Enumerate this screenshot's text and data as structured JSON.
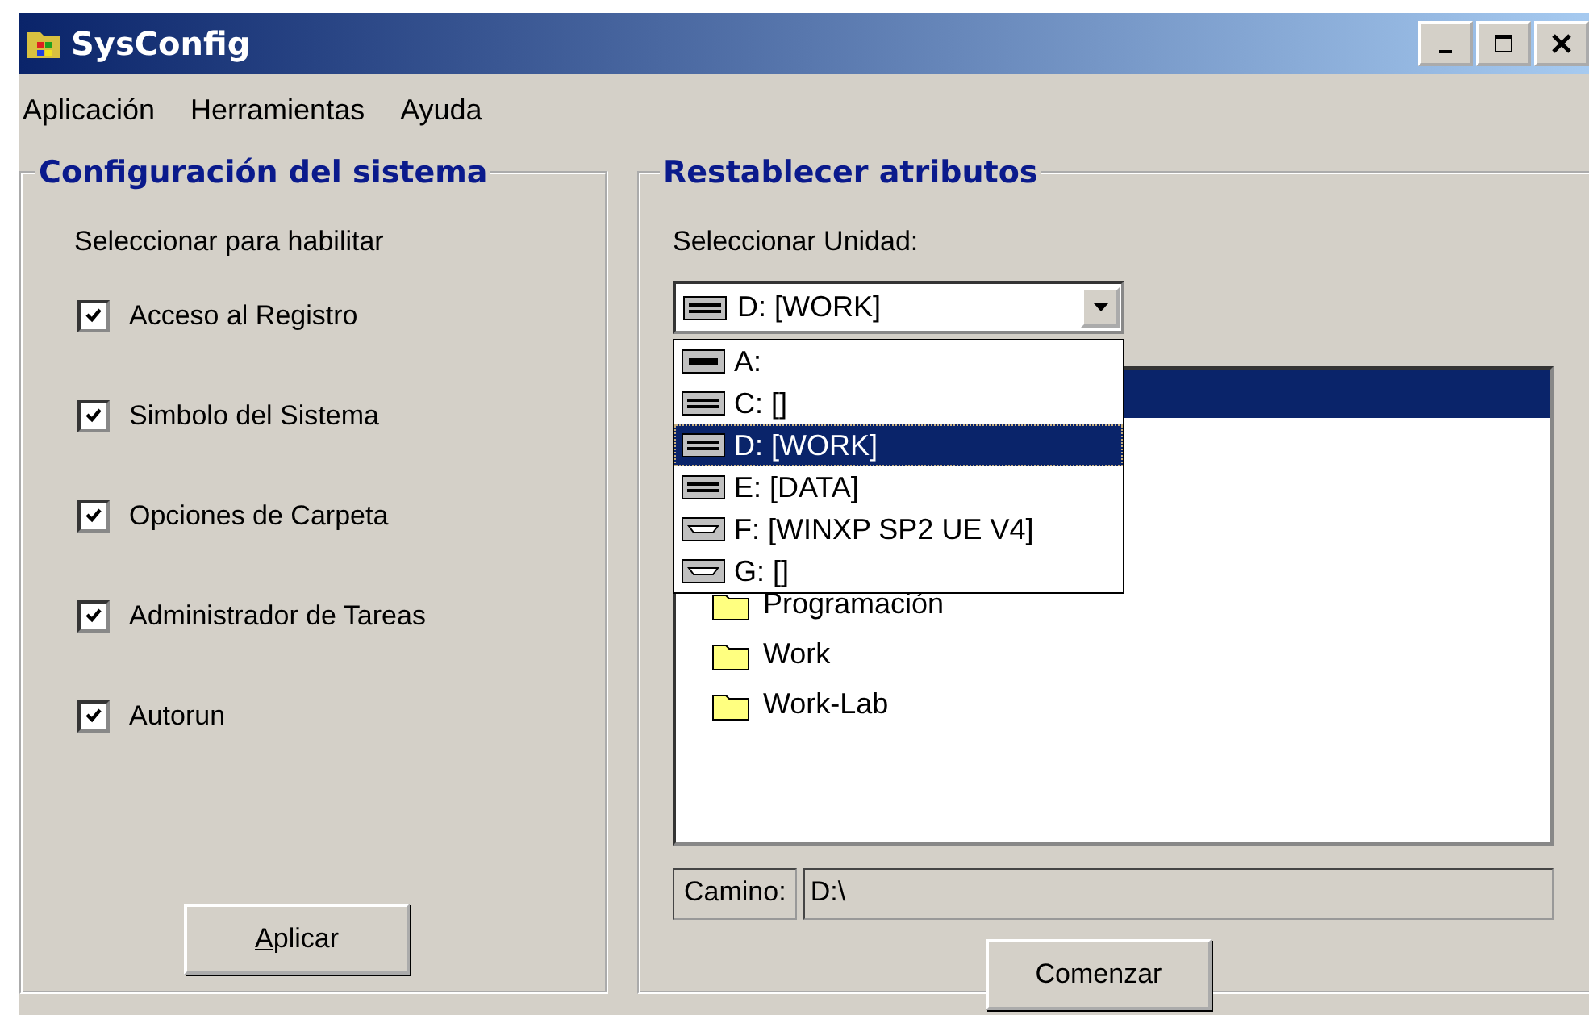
{
  "window": {
    "title": "SysConfig"
  },
  "menu": [
    "Aplicación",
    "Herramientas",
    "Ayuda"
  ],
  "left_panel": {
    "title": "Configuración del sistema",
    "subtitle": "Seleccionar para habilitar",
    "options": [
      {
        "label": "Acceso al Registro",
        "checked": true
      },
      {
        "label": "Simbolo del Sistema",
        "checked": true
      },
      {
        "label": "Opciones de Carpeta",
        "checked": true
      },
      {
        "label": "Administrador de Tareas",
        "checked": true
      },
      {
        "label": "Autorun",
        "checked": true
      }
    ],
    "button": "Aplicar"
  },
  "right_panel": {
    "title": "Restablecer atributos",
    "drive_label": "Seleccionar Unidad:",
    "drive_combo": {
      "value": "D: [WORK]",
      "kind": "hdd"
    },
    "drives": [
      {
        "label": "A:",
        "kind": "floppy",
        "selected": false
      },
      {
        "label": "C: []",
        "kind": "hdd",
        "selected": false
      },
      {
        "label": "D: [WORK]",
        "kind": "hdd",
        "selected": true
      },
      {
        "label": "E: [DATA]",
        "kind": "hdd",
        "selected": false
      },
      {
        "label": "F: [WINXP SP2 UE V4]",
        "kind": "cdrom",
        "selected": false
      },
      {
        "label": "G: []",
        "kind": "cdrom",
        "selected": false
      }
    ],
    "folders": [
      {
        "selected": true
      },
      {
        "label": "Programación",
        "selected": false
      },
      {
        "label": "Work",
        "selected": false
      },
      {
        "label": "Work-Lab",
        "selected": false
      }
    ],
    "path_label": "Camino:",
    "path_value": "D:\\",
    "button": "Comenzar"
  }
}
